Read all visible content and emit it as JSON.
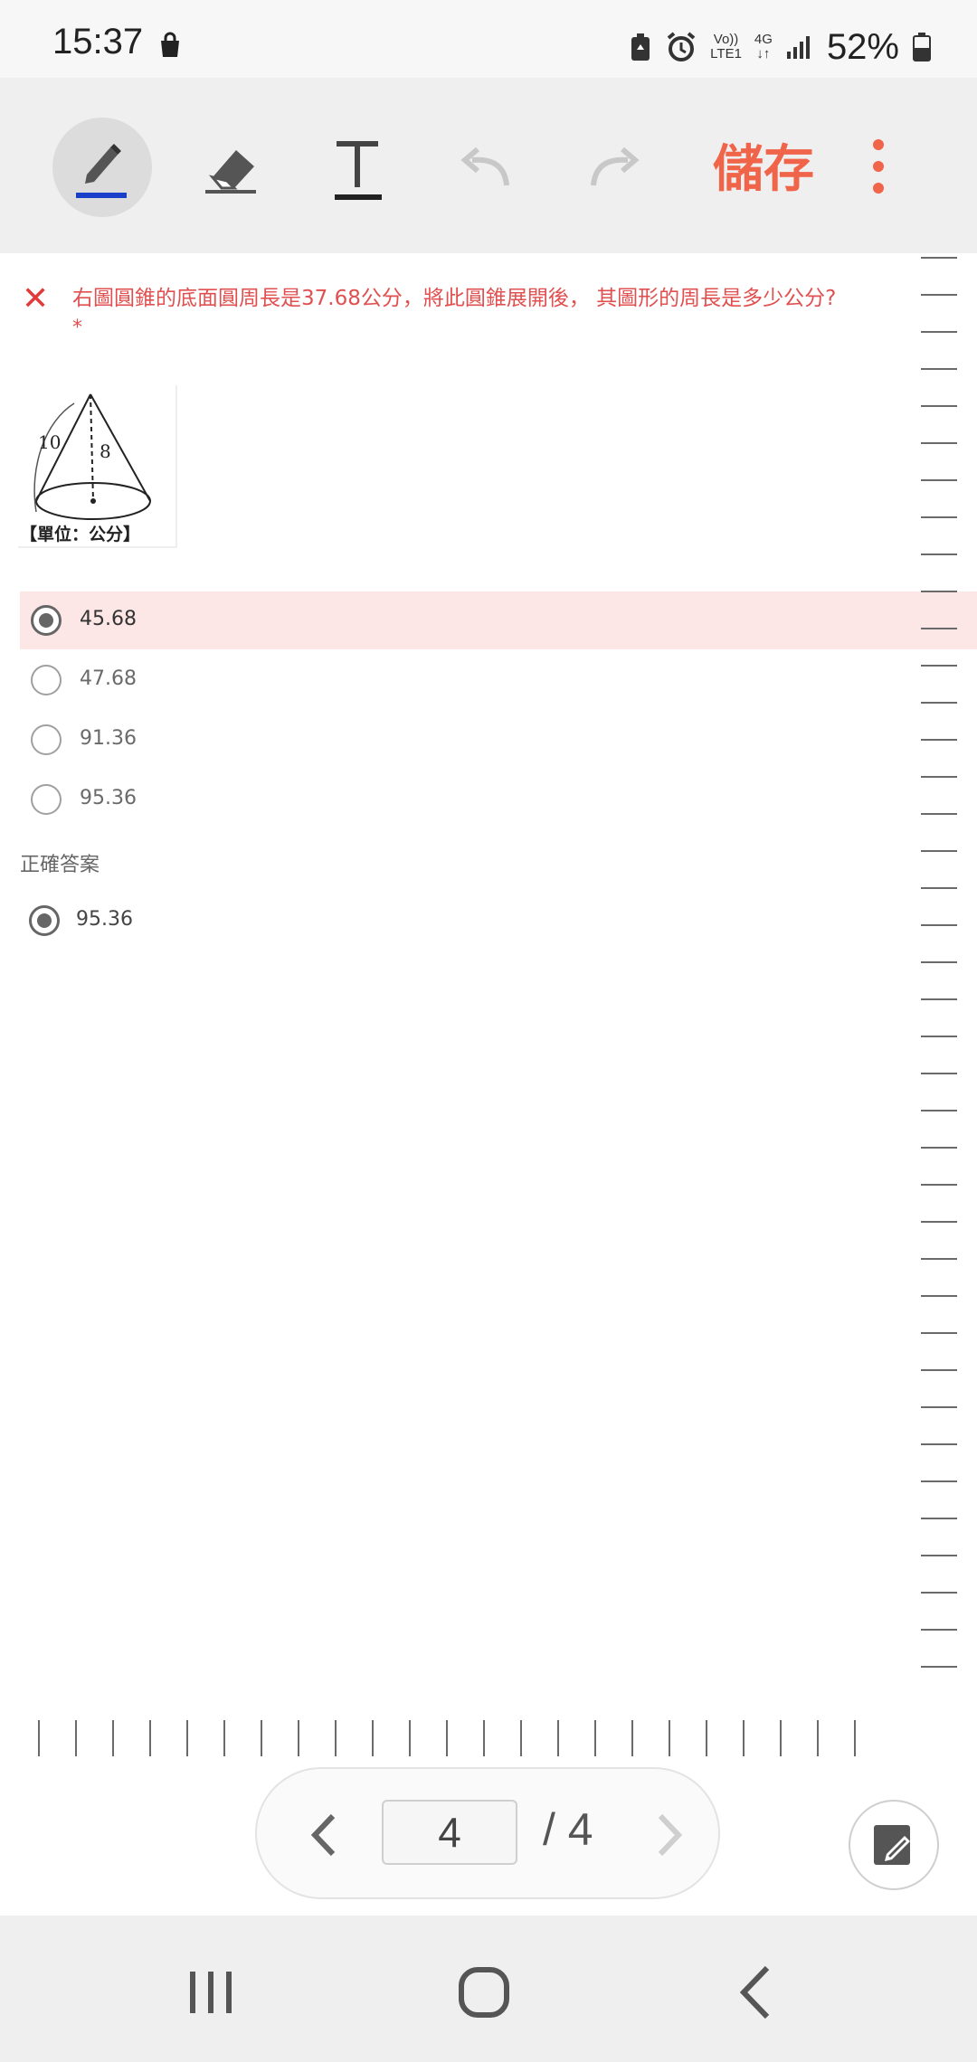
{
  "status_bar": {
    "time": "15:37",
    "network_label_top": "Vo))",
    "network_label_bottom": "LTE1",
    "network_gen": "4G",
    "battery_percent": "52%"
  },
  "toolbar": {
    "pen_label": "pen",
    "save_label": "儲存",
    "accent_color": "#f0644a",
    "pen_color": "#1a3fc9"
  },
  "question": {
    "status_mark": "✕",
    "text": "右圖圓錐的底面圓周長是37.68公分，將此圓錐展開後， 其圖形的周長是多少公分?",
    "required_mark": "*",
    "figure": {
      "slant_label": "10",
      "height_label": "8",
      "unit_caption": "【單位：公分】"
    },
    "options": [
      {
        "label": "45.68",
        "selected": true,
        "state": "wrong"
      },
      {
        "label": "47.68",
        "selected": false
      },
      {
        "label": "91.36",
        "selected": false
      },
      {
        "label": "95.36",
        "selected": false
      }
    ],
    "correct_heading": "正確答案",
    "correct_answer": "95.36"
  },
  "pager": {
    "current_page": "4",
    "total_label": "/ 4"
  }
}
